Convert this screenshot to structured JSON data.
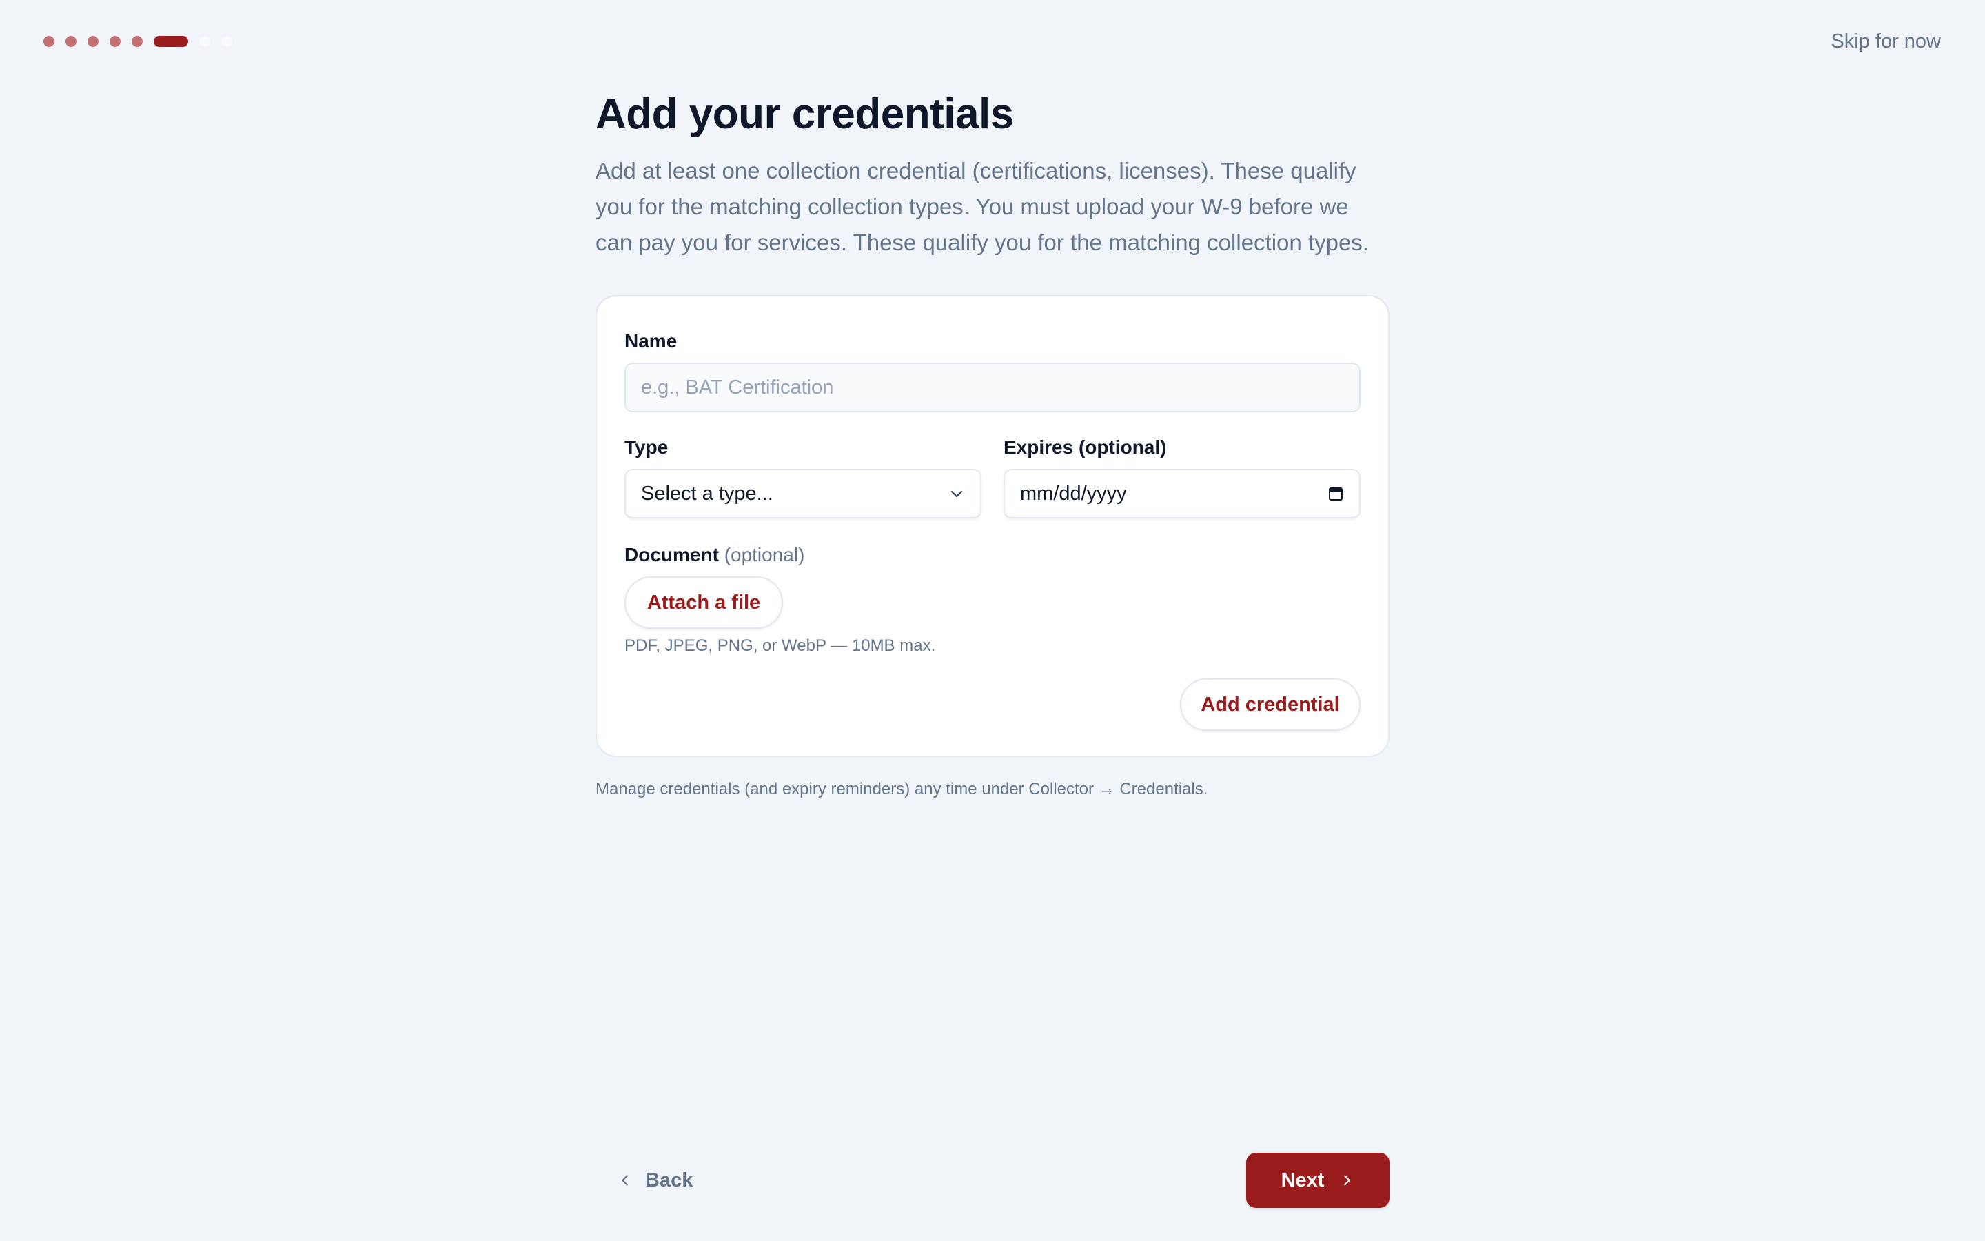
{
  "progress": {
    "total_steps": 8,
    "current_step": 6
  },
  "header": {
    "skip_label": "Skip for now"
  },
  "page": {
    "title": "Add your credentials",
    "description": "Add at least one collection credential (certifications, licenses). These qualify you for the matching collection types. You must upload your W-9 before we can pay you for services. These qualify you for the matching collection types."
  },
  "form": {
    "name_label": "Name",
    "name_placeholder": "e.g., BAT Certification",
    "name_value": "",
    "type_label": "Type",
    "type_selected": "Select a type...",
    "expires_label": "Expires (optional)",
    "expires_placeholder": "mm/dd/yyyy",
    "document_label": "Document",
    "document_optional": "(optional)",
    "attach_label": "Attach a file",
    "file_hint": "PDF, JPEG, PNG, or WebP — 10MB max.",
    "add_label": "Add credential"
  },
  "footnote": "Manage credentials (and expiry reminders) any time under Collector → Credentials.",
  "nav": {
    "back_label": "Back",
    "next_label": "Next"
  },
  "colors": {
    "accent": "#9b1c1c",
    "completed_dot": "#c07070",
    "background": "#f1f5f9",
    "muted_text": "#64748b"
  },
  "icons": {
    "select": "chevron-down-icon",
    "date": "calendar-icon",
    "back": "chevron-left-icon",
    "next": "chevron-right-icon"
  }
}
